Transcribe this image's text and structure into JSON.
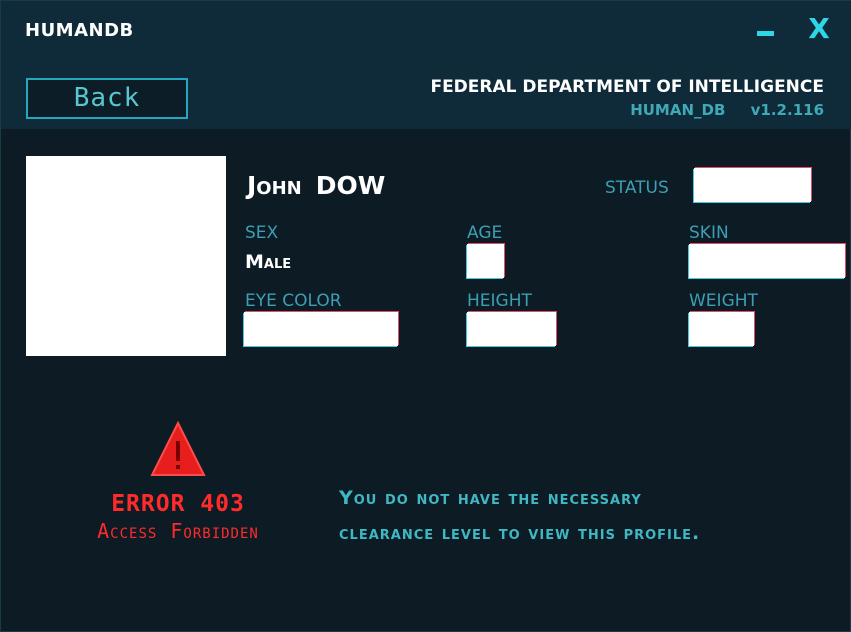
{
  "window": {
    "title": "HUMANDB",
    "minimize_glyph": "",
    "close_glyph": "X"
  },
  "header": {
    "back_label": "Back",
    "org_name": "FEDERAL DEPARTMENT OF INTELLIGENCE",
    "db_name": "HUMAN_DB",
    "version": "v1.2.116"
  },
  "profile": {
    "first_name": "John",
    "last_name": "DOW",
    "labels": {
      "status": "STATUS",
      "sex": "SEX",
      "age": "AGE",
      "skin": "SKIN",
      "eye_color": "EYE COLOR",
      "height": "HEIGHT",
      "weight": "WEIGHT"
    },
    "values": {
      "sex": "Male"
    }
  },
  "error": {
    "code": "ERROR 403",
    "text": "Access Forbidden",
    "message_line1": "You do not have the necessary",
    "message_line2": "clearance level to view this profile."
  },
  "colors": {
    "background": "#0c1b24",
    "header_band": "#0f2a38",
    "accent_cyan": "#2fd6e6",
    "label_teal": "#3d9fb3",
    "error_red": "#ff2b2b"
  },
  "icons": {
    "minimize": "minimize-icon",
    "close": "close-icon",
    "warning": "warning-triangle-icon"
  }
}
